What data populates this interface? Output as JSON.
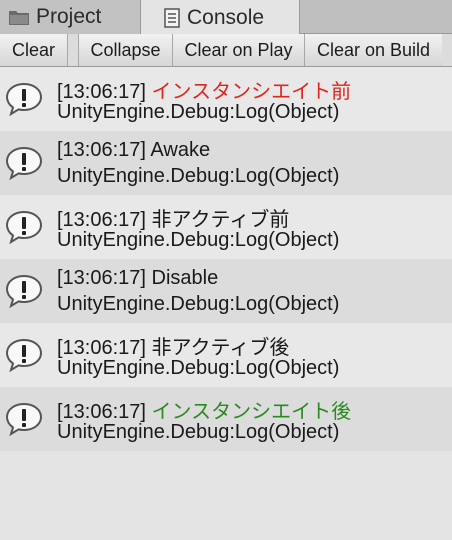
{
  "tabs": {
    "project": {
      "label": "Project",
      "icon": "folder-icon"
    },
    "console": {
      "label": "Console",
      "icon": "console-icon"
    }
  },
  "toolbar": {
    "clear": "Clear",
    "collapse": "Collapse",
    "clear_on_play": "Clear on Play",
    "clear_on_build": "Clear on Build"
  },
  "colors": {
    "red_message": "#e0241e",
    "green_message": "#2a8a1f"
  },
  "logs": [
    {
      "timestamp": "[13:06:17]",
      "message": "インスタンシエイト前",
      "stack": "UnityEngine.Debug:Log(Object)",
      "color": "red"
    },
    {
      "timestamp": "[13:06:17]",
      "message": "Awake",
      "stack": "UnityEngine.Debug:Log(Object)",
      "color": "normal"
    },
    {
      "timestamp": "[13:06:17]",
      "message": "非アクティブ前",
      "stack": "UnityEngine.Debug:Log(Object)",
      "color": "normal"
    },
    {
      "timestamp": "[13:06:17]",
      "message": "Disable",
      "stack": "UnityEngine.Debug:Log(Object)",
      "color": "normal"
    },
    {
      "timestamp": "[13:06:17]",
      "message": "非アクティブ後",
      "stack": "UnityEngine.Debug:Log(Object)",
      "color": "normal"
    },
    {
      "timestamp": "[13:06:17]",
      "message": "インスタンシエイト後",
      "stack": "UnityEngine.Debug:Log(Object)",
      "color": "green"
    }
  ]
}
